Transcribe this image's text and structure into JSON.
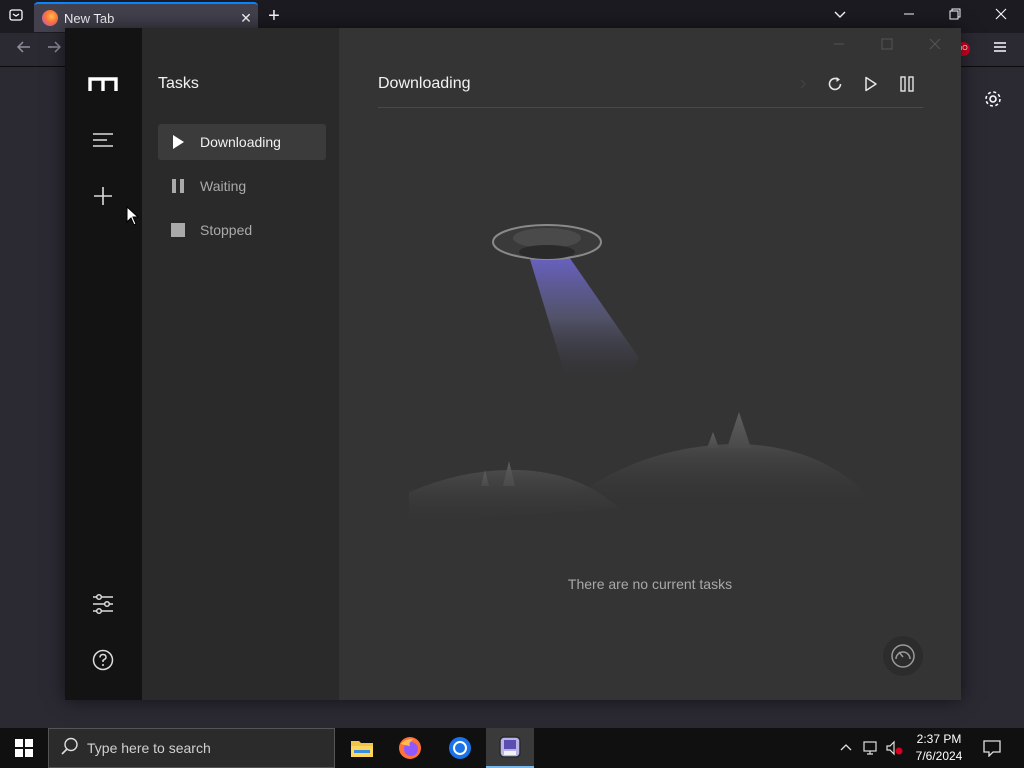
{
  "browser": {
    "tab_title": "New Tab",
    "tab_close": "✕",
    "new_tab": "+",
    "badge_text": "uO"
  },
  "motrix": {
    "sidebar_title": "Tasks",
    "nav": [
      {
        "label": "Downloading",
        "active": true
      },
      {
        "label": "Waiting",
        "active": false
      },
      {
        "label": "Stopped",
        "active": false
      }
    ],
    "main_title": "Downloading",
    "empty_message": "There are no current tasks"
  },
  "taskbar": {
    "search_placeholder": "Type here to search",
    "time": "2:37 PM",
    "date": "7/6/2024"
  },
  "colors": {
    "accent": "#0a84ff",
    "motrix_bg": "#343434",
    "taskbar_active": "#76b9ed"
  }
}
